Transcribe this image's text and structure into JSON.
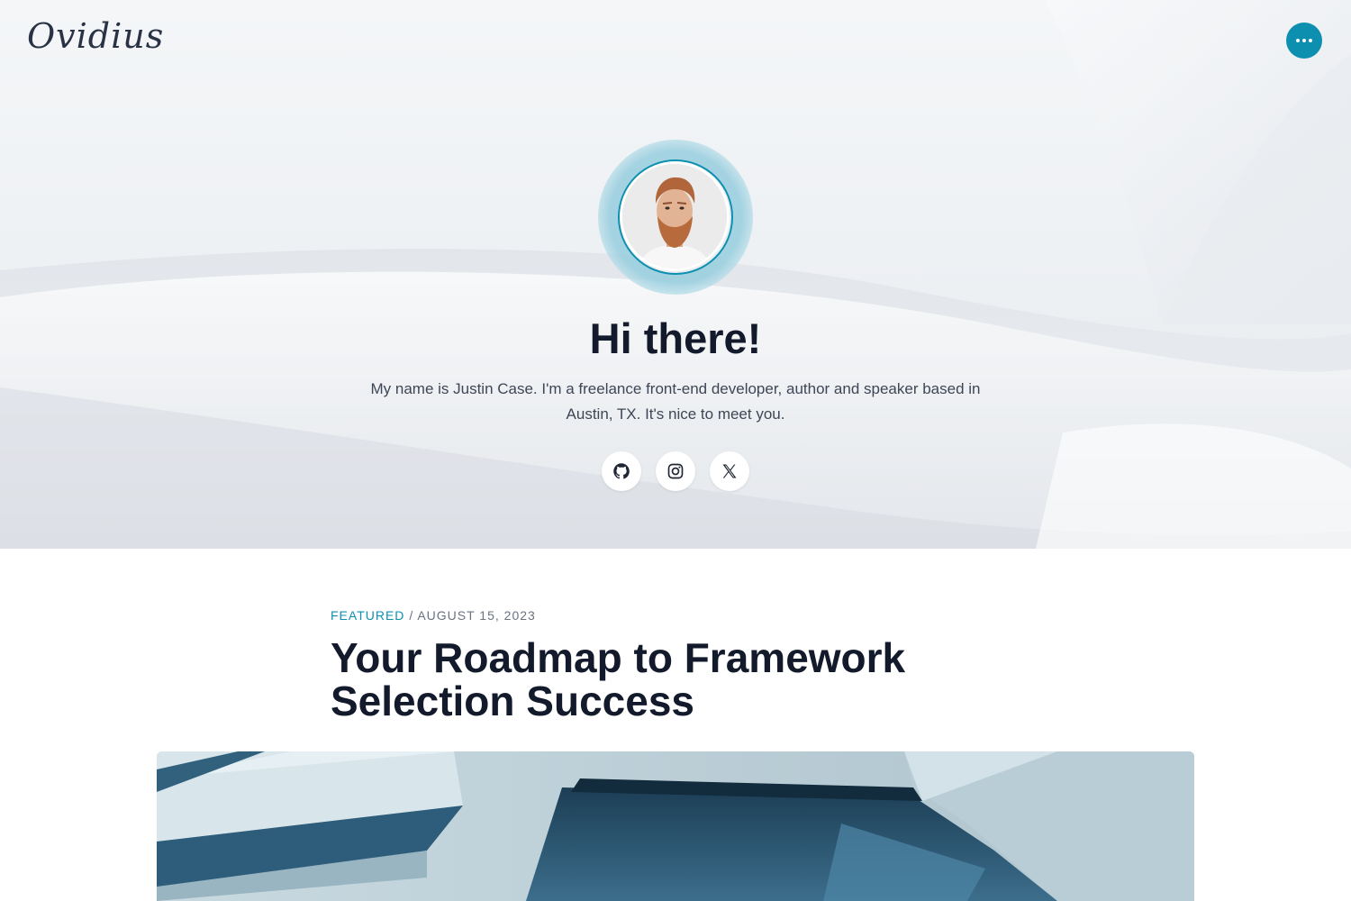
{
  "header": {
    "logo_text": "Ovidius",
    "menu_icon": "more-horizontal-icon"
  },
  "hero": {
    "title": "Hi there!",
    "intro": "My name is Justin Case. I'm a freelance front-end developer, author and speaker based in Austin, TX. It's nice to meet you.",
    "social_links": [
      {
        "name": "github",
        "icon": "github-icon"
      },
      {
        "name": "instagram",
        "icon": "instagram-icon"
      },
      {
        "name": "x",
        "icon": "x-icon"
      }
    ]
  },
  "post": {
    "category": "FEATURED",
    "separator": "/",
    "date": "AUGUST 15, 2023",
    "title": "Your Roadmap to Framework Selection Success"
  },
  "colors": {
    "accent": "#0d8fb0",
    "heading": "#131a2b",
    "text": "#3e4656",
    "meta": "#6b7280"
  }
}
